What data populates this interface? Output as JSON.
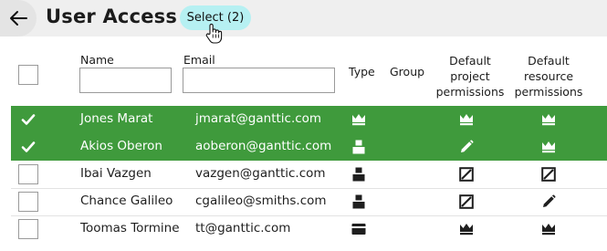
{
  "header": {
    "title": "User Access",
    "select_label": "Select (2)"
  },
  "columns": {
    "name": "Name",
    "email": "Email",
    "type": "Type",
    "group": "Group",
    "project": [
      "Default",
      "project",
      "permissions"
    ],
    "resource": [
      "Default",
      "resource",
      "permissions"
    ]
  },
  "filters": {
    "name_value": "",
    "email_value": ""
  },
  "rows": [
    {
      "name": "Jones Marat",
      "email": "jmarat@ganttic.com",
      "selected": true,
      "type_icon": "crown-icon",
      "project_icon": "crown-icon",
      "resource_icon": "crown-icon"
    },
    {
      "name": "Akios Oberon",
      "email": "aoberon@ganttic.com",
      "selected": true,
      "type_icon": "user-icon",
      "project_icon": "pencil-icon",
      "resource_icon": "crown-icon"
    },
    {
      "name": "Ibai Vazgen",
      "email": "vazgen@ganttic.com",
      "selected": false,
      "type_icon": "user-icon",
      "project_icon": "no-access-icon",
      "resource_icon": "no-access-icon"
    },
    {
      "name": "Chance Galileo",
      "email": "cgalileo@smiths.com",
      "selected": false,
      "type_icon": "user-icon",
      "project_icon": "no-access-icon",
      "resource_icon": "pencil-icon"
    },
    {
      "name": "Toomas Tormine",
      "email": "tt@ganttic.com",
      "selected": false,
      "type_icon": "card-icon",
      "project_icon": "crown-icon",
      "resource_icon": "crown-icon"
    }
  ],
  "colors": {
    "selected_row": "#3f9a3c",
    "select_button": "#b6f0f2",
    "header_bar": "#efefef"
  }
}
